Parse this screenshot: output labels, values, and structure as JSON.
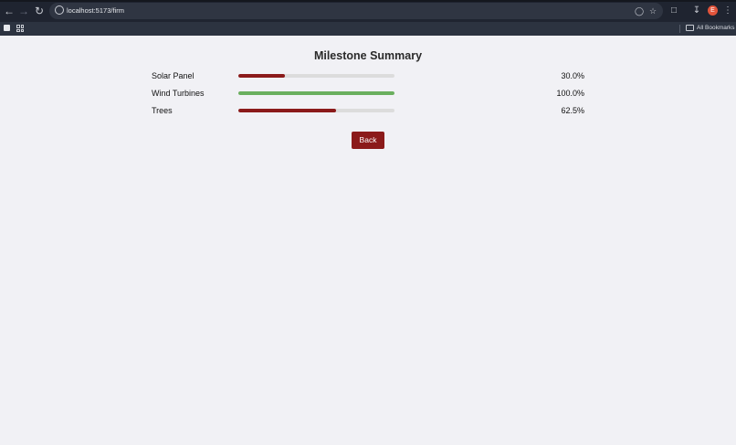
{
  "browser": {
    "url": "localhost:5173/firm",
    "bookmarks_label": "All Bookmarks",
    "profile_initial": "E"
  },
  "page": {
    "title": "Milestone Summary",
    "milestones": [
      {
        "label": "Solar Panel",
        "percent_text": "30.0%",
        "progress": 0.3,
        "color": "#8b1a1a"
      },
      {
        "label": "Wind Turbines",
        "percent_text": "100.0%",
        "progress": 1.0,
        "color": "#6aaf5e"
      },
      {
        "label": "Trees",
        "percent_text": "62.5%",
        "progress": 0.625,
        "color": "#8b1a1a"
      }
    ],
    "back_label": "Back"
  },
  "colors": {
    "accent": "#8b1a1a",
    "complete": "#6aaf5e",
    "track": "#dcdcdc",
    "background": "#f1f1f5"
  },
  "icons": {
    "back": "arrow-left-icon",
    "forward": "arrow-right-icon",
    "reload": "reload-icon",
    "site_info": "site-info-icon",
    "password": "key-icon",
    "bookmark": "star-icon",
    "extensions": "puzzle-icon",
    "downloads": "download-icon",
    "menu": "kebab-menu-icon",
    "folder": "folder-icon"
  }
}
